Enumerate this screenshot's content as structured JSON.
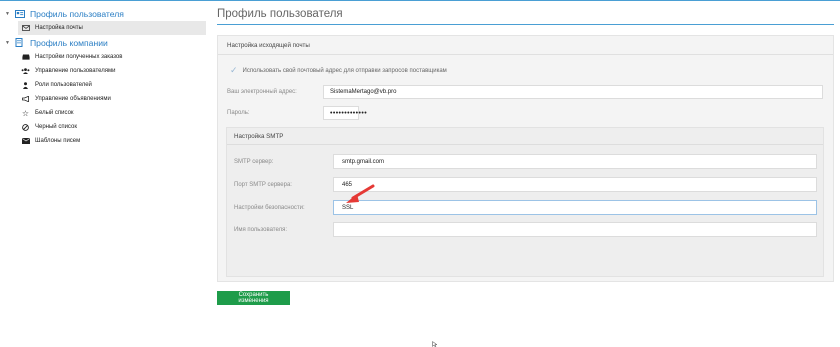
{
  "sidebar": {
    "groups": [
      {
        "label": "Профиль пользователя",
        "icon": "user-card-icon",
        "items": [
          {
            "label": "Настройка почты",
            "icon": "envelope-icon",
            "selected": true
          }
        ]
      },
      {
        "label": "Профиль компании",
        "icon": "building-icon",
        "items": [
          {
            "label": "Настройки полученных заказов",
            "icon": "inbox-icon"
          },
          {
            "label": "Управление пользователями",
            "icon": "users-icon"
          },
          {
            "label": "Роли пользователей",
            "icon": "user-lock-icon"
          },
          {
            "label": "Управление объявлениями",
            "icon": "bullhorn-icon"
          },
          {
            "label": "Белый список",
            "icon": "star-icon"
          },
          {
            "label": "Черный список",
            "icon": "ban-icon"
          },
          {
            "label": "Шаблоны писем",
            "icon": "envelope-filled-icon"
          }
        ]
      }
    ]
  },
  "main": {
    "title": "Профиль пользователя",
    "panel_title": "Настройка исходящей почты",
    "use_own_address_label": "Использовать свой почтовый адрес для отправки запросов поставщикам",
    "use_own_address_checked": true,
    "email": {
      "label": "Ваш электронный адрес:",
      "value": "SistemaMertago@vb.pro"
    },
    "password": {
      "label": "Пароль:",
      "value": "•••••••••••••"
    },
    "smtp": {
      "title": "Настройка SMTP",
      "server": {
        "label": "SMTP сервер:",
        "value": "smtp.gmail.com"
      },
      "port": {
        "label": "Порт SMTP сервера:",
        "value": "465"
      },
      "security": {
        "label": "Настройки безопасности:",
        "value": "SSL"
      },
      "username": {
        "label": "Имя пользователя:",
        "value": ""
      }
    },
    "save_label": "Сохранить изменения"
  },
  "colors": {
    "accent": "#2a7ec4",
    "rule": "#4a9fd4",
    "save_button": "#1e9c4a",
    "annotation_arrow": "#e53935"
  }
}
